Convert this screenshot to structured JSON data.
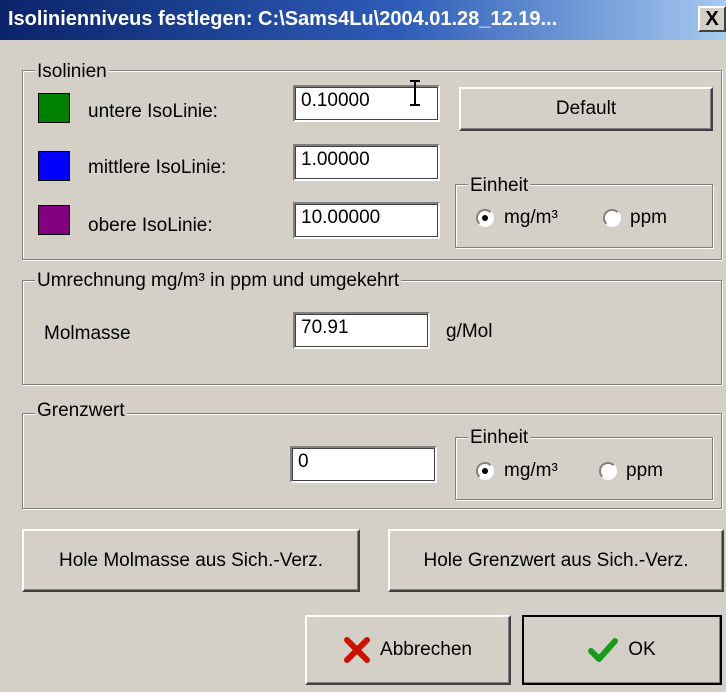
{
  "window": {
    "title": "Isolinienniveus festlegen: C:\\Sams4Lu\\2004.01.28_12.19...",
    "close_label": "X"
  },
  "isolinien": {
    "legend": "Isolinien",
    "rows": [
      {
        "label": "untere IsoLinie:",
        "value": "0.10000",
        "color": "#008000"
      },
      {
        "label": "mittlere IsoLinie:",
        "value": "1.00000",
        "color": "#0000ff"
      },
      {
        "label": "obere IsoLinie:",
        "value": "10.00000",
        "color": "#800080"
      }
    ],
    "default_button": "Default",
    "unit_group": {
      "legend": "Einheit",
      "options": [
        "mg/m³",
        "ppm"
      ],
      "selected": "mg/m³"
    }
  },
  "umrechnung": {
    "legend": "Umrechnung mg/m³ in ppm und umgekehrt",
    "molmasse_label": "Molmasse",
    "molmasse_value": "70.91",
    "unit": "g/Mol"
  },
  "grenzwert": {
    "legend": "Grenzwert",
    "value": "0",
    "unit_group": {
      "legend": "Einheit",
      "options": [
        "mg/m³",
        "ppm"
      ],
      "selected": "mg/m³"
    }
  },
  "buttons": {
    "hole_molmasse": "Hole Molmasse aus Sich.-Verz.",
    "hole_grenzwert": "Hole Grenzwert aus Sich.-Verz.",
    "abbrechen": "Abbrechen",
    "ok": "OK"
  }
}
